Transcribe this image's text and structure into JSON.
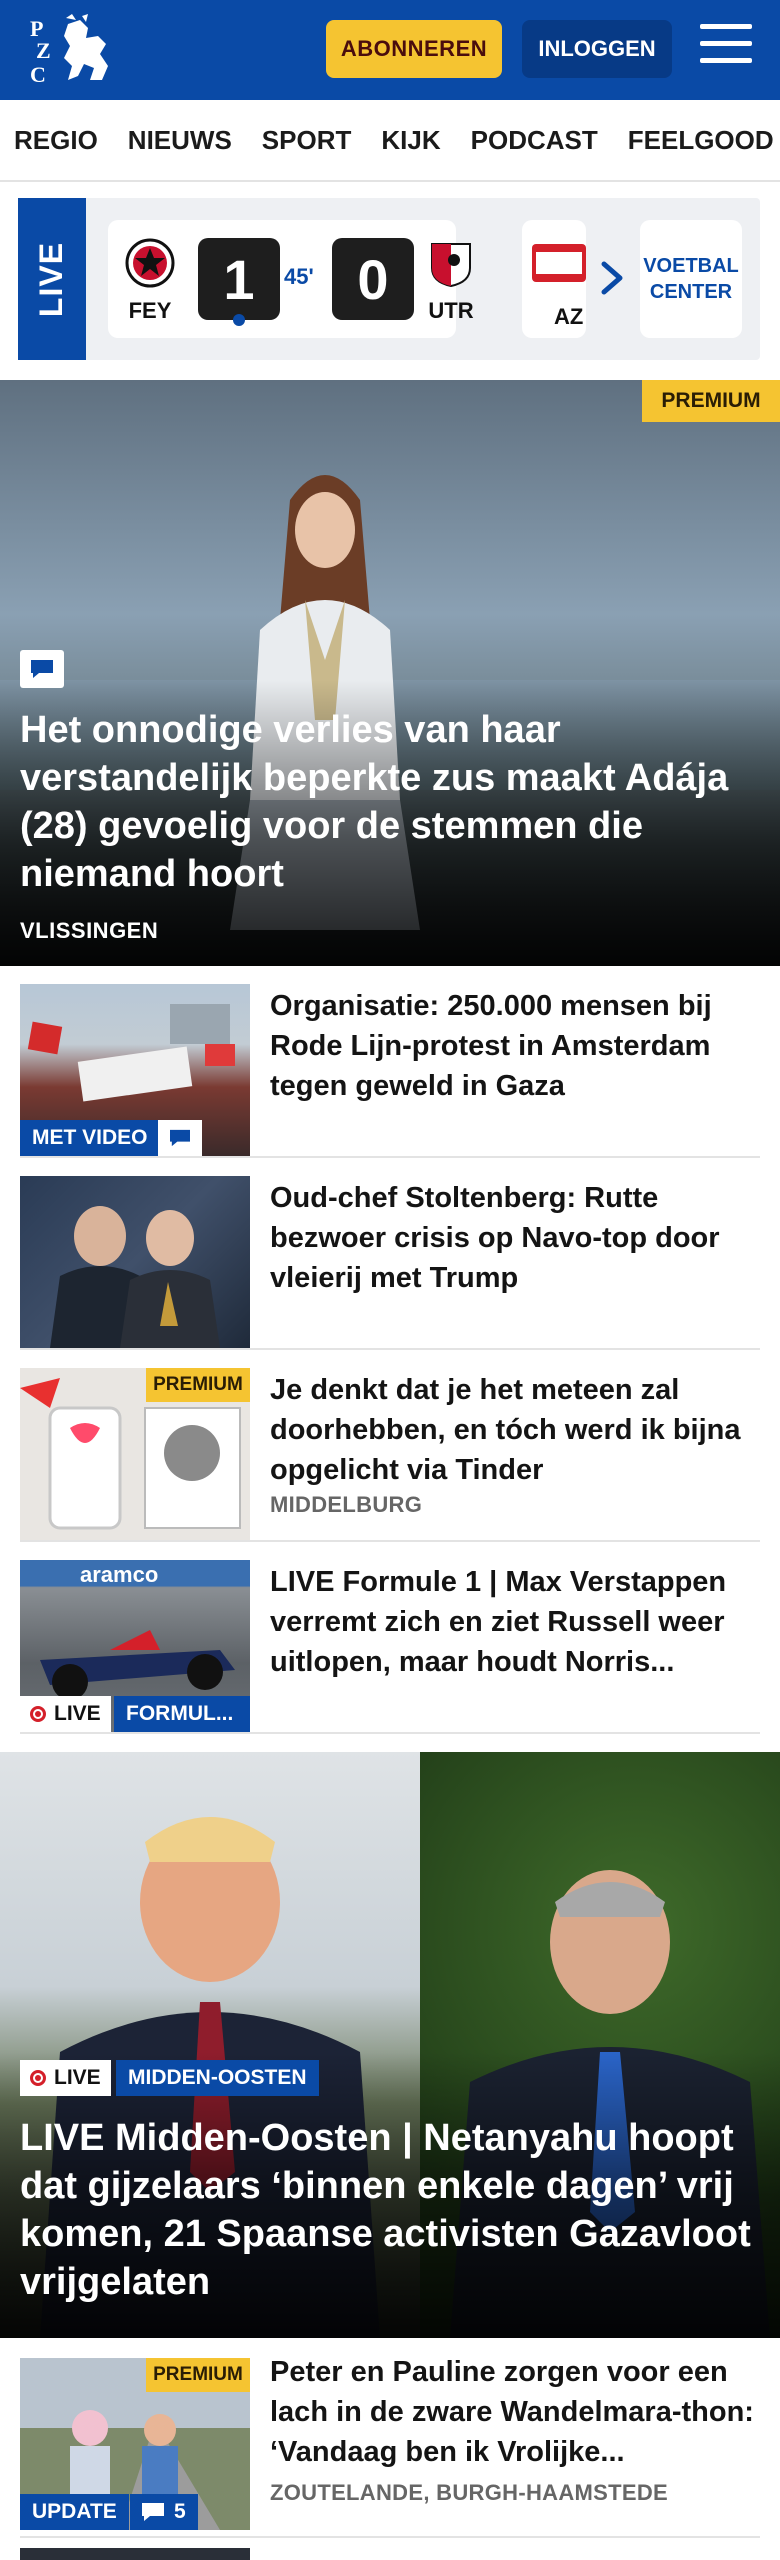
{
  "header": {
    "logo_text": "PZC",
    "subscribe_label": "ABONNEREN",
    "login_label": "INLOGGEN",
    "brand_color": "#0a4aa6",
    "accent_color": "#f5c431"
  },
  "nav": {
    "items": [
      "REGIO",
      "NIEUWS",
      "SPORT",
      "KIJK",
      "PODCAST",
      "FEELGOOD"
    ]
  },
  "livebar": {
    "live_label": "LIVE",
    "match": {
      "home": "FEY",
      "away": "UTR",
      "home_score": "1",
      "away_score": "0",
      "minute": "45'"
    },
    "next_match_team": "AZ",
    "center_label": "VOETBAL CENTER"
  },
  "hero": {
    "badge": "PREMIUM",
    "title": "Het onnodige verlies van haar verstandelijk beperkte zus maakt Adája (28) gevoelig voor de stemmen die niemand hoort",
    "location": "VLISSINGEN"
  },
  "articles": [
    {
      "title": "Organisatie: 250.000 mensen bij Rode Lijn-protest in Amsterdam tegen geweld in Gaza",
      "badge": "MET VIDEO"
    },
    {
      "title": "Oud-chef Stoltenberg: Rutte bezwoer crisis op Navo-top door vleierij met Trump"
    },
    {
      "title": "Je denkt dat je het meteen zal doorhebben, en tóch werd ik bijna opgelicht via Tinder",
      "badge": "PREMIUM",
      "location": "MIDDELBURG"
    },
    {
      "title": "LIVE Formule 1 | Max Verstappen verremt zich en ziet Russell weer uitlopen, maar houdt Norris...",
      "live_label": "LIVE",
      "category": "FORMUL..."
    }
  ],
  "feature": {
    "live_label": "LIVE",
    "category": "MIDDEN-OOSTEN",
    "title": "LIVE Midden-Oosten | Netanyahu hoopt dat gijzelaars ‘binnen enkele dagen’ vrij komen, 21 Spaanse activisten Gazavloot vrijgelaten"
  },
  "last_article": {
    "badge": "PREMIUM",
    "title": "Peter en Pauline zorgen voor een lach in de zware Wandelmara-thon: ‘Vandaag ben ik Vrolijke...",
    "update_label": "UPDATE",
    "comment_count": "5",
    "location": "ZOUTELANDE, BURGH-HAAMSTEDE"
  }
}
